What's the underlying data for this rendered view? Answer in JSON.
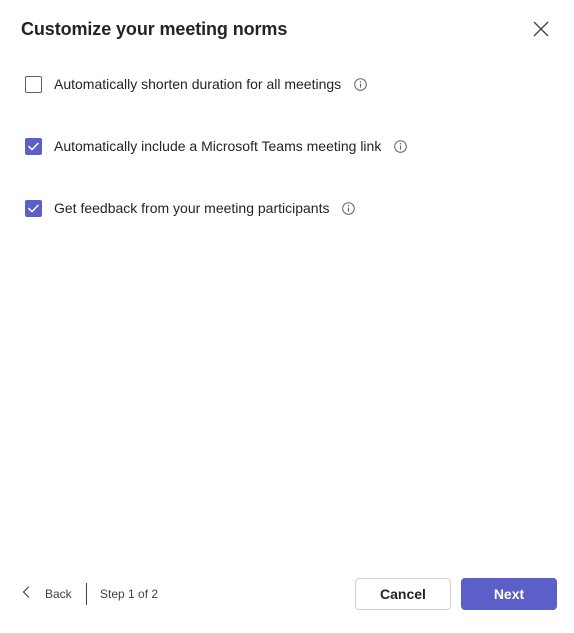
{
  "dialog": {
    "title": "Customize your meeting norms",
    "close_icon": "close-icon"
  },
  "options": [
    {
      "label": "Automatically shorten duration for all meetings",
      "checked": false,
      "info_icon": "info-icon"
    },
    {
      "label": "Automatically include a Microsoft Teams meeting link",
      "checked": true,
      "info_icon": "info-icon"
    },
    {
      "label": "Get feedback from your meeting participants",
      "checked": true,
      "info_icon": "info-icon"
    }
  ],
  "footer": {
    "back_label": "Back",
    "back_icon": "chevron-left-icon",
    "step_text": "Step 1 of 2",
    "cancel_label": "Cancel",
    "next_label": "Next"
  },
  "colors": {
    "accent": "#5b5fc7",
    "text": "#242424",
    "border": "#d1d1d1"
  }
}
